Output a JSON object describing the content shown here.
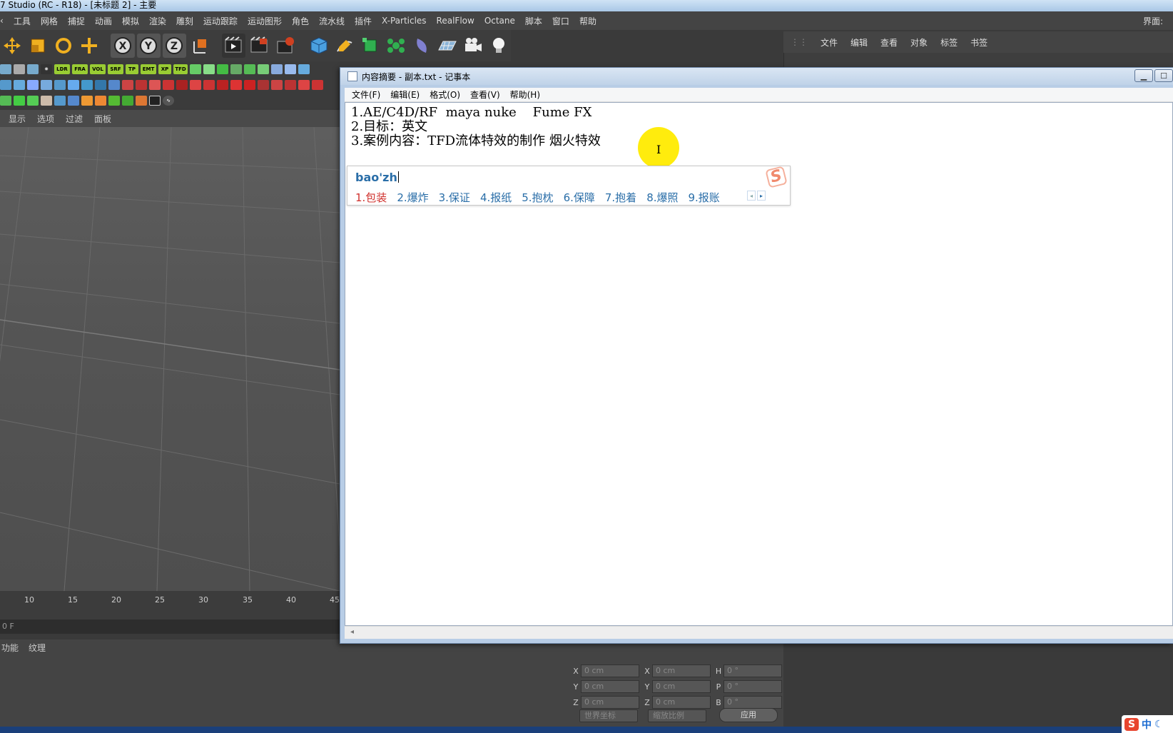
{
  "c4d": {
    "title": "7 Studio (RC - R18) - [未标题 2] - 主要",
    "menu": [
      "工具",
      "网格",
      "捕捉",
      "动画",
      "模拟",
      "渲染",
      "雕刻",
      "运动跟踪",
      "运动图形",
      "角色",
      "流水线",
      "插件",
      "X-Particles",
      "RealFlow",
      "Octane",
      "脚本",
      "窗口",
      "帮助"
    ],
    "layout_label": "界面:",
    "plugin_row": [
      "LDR",
      "FRA",
      "VOL",
      "SRF",
      "TP",
      "EMT",
      "XP",
      "TFD"
    ],
    "viewport_menu": [
      "显示",
      "选项",
      "过滤",
      "面板"
    ],
    "timeline_ticks": [
      "10",
      "15",
      "20",
      "25",
      "30",
      "35",
      "40",
      "45"
    ],
    "frame_field": "0 F",
    "bottom_tabs": [
      "功能",
      "纹理"
    ],
    "right_panel_menu": [
      "文件",
      "编辑",
      "查看",
      "对象",
      "标签",
      "书签"
    ],
    "coords": {
      "labels_col1": [
        "X",
        "Y",
        "Z"
      ],
      "labels_col2": [
        "X",
        "Y",
        "Z"
      ],
      "labels_col3": [
        "H",
        "P",
        "B"
      ],
      "pos_values": [
        "0 cm",
        "0 cm",
        "0 cm"
      ],
      "size_values": [
        "0 cm",
        "0 cm",
        "0 cm"
      ],
      "rot_values": [
        "0 °",
        "0 °",
        "0 °"
      ],
      "dropdown1": "世界坐标",
      "dropdown2": "缩放比例",
      "apply": "应用"
    }
  },
  "notepad": {
    "title": "内容摘要 - 副本.txt - 记事本",
    "menu": [
      "文件(F)",
      "编辑(E)",
      "格式(O)",
      "查看(V)",
      "帮助(H)"
    ],
    "lines": [
      "1.AE/C4D/RF  maya nuke    Fume FX",
      "2.目标：英文",
      "3.案例内容：TFD流体特效的制作 烟火特效"
    ]
  },
  "ime": {
    "composition": "bao'zh",
    "candidates": [
      "1.包装",
      "2.爆炸",
      "3.保证",
      "4.报纸",
      "5.抱枕",
      "6.保障",
      "7.抱着",
      "8.爆照",
      "9.报账"
    ],
    "logo": "S",
    "tray_lang": "中",
    "accent": "#2a6ea8",
    "first_candidate_color": "#d0312d"
  }
}
